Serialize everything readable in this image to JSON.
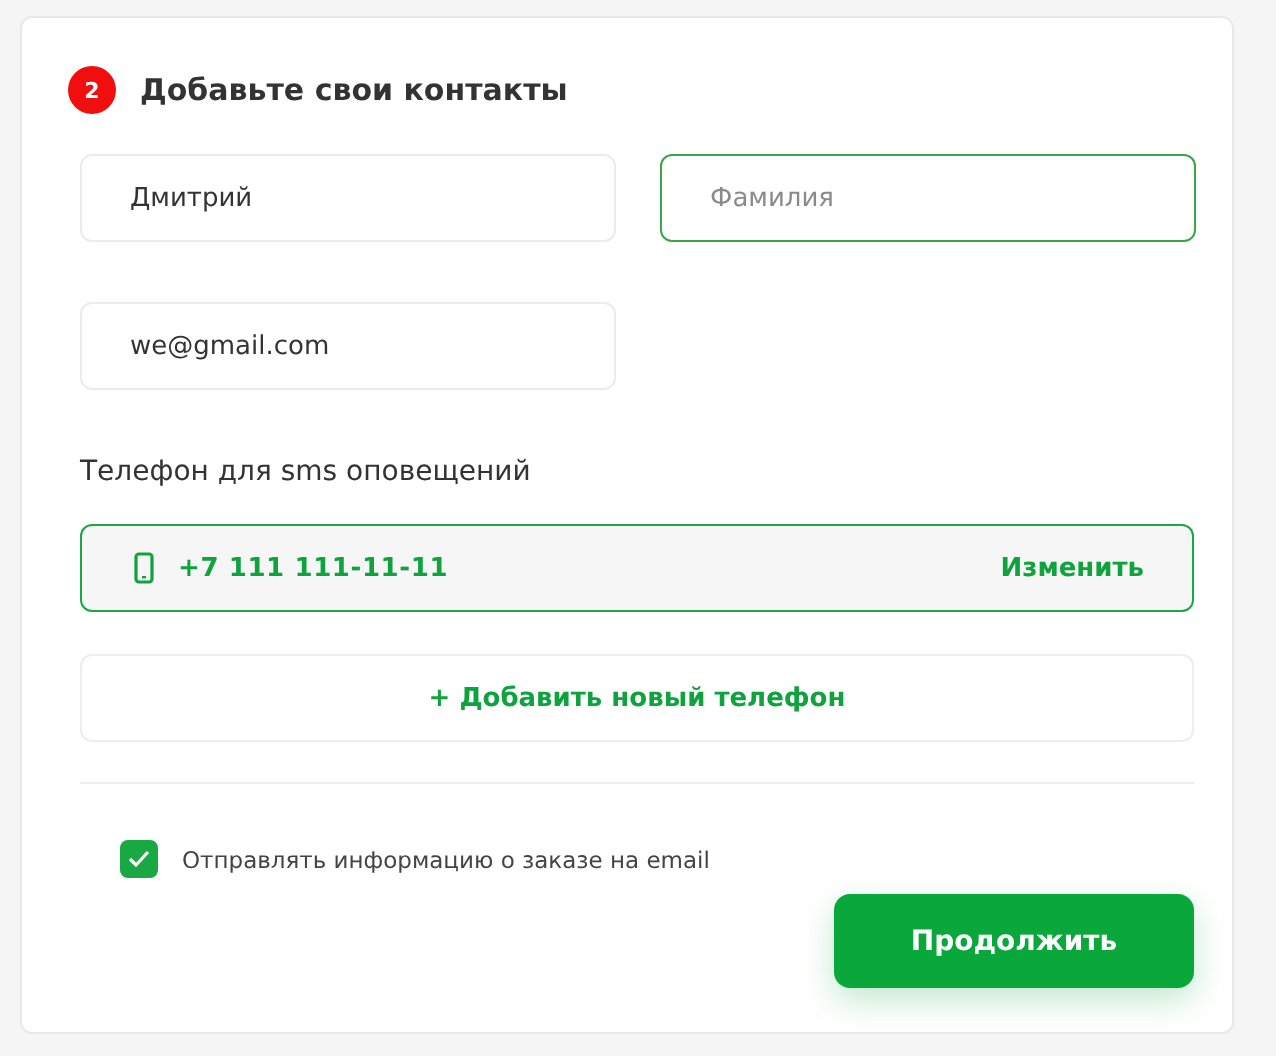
{
  "step": {
    "number": "2",
    "title": "Добавьте свои контакты"
  },
  "fields": [
    {
      "value": "Дмитрий",
      "focused": false
    },
    {
      "placeholder": "Фамилия",
      "focused": true
    },
    {
      "value": "we@gmail.com",
      "focused": false
    }
  ],
  "phone_section": {
    "label": "Телефон для sms оповещений",
    "phone": "+7 111 111-11-11",
    "change_link": "Изменить",
    "add_button": "+ Добавить новый телефон"
  },
  "email_notify": {
    "label": "Отправлять информацию о заказе на email",
    "checked": true
  },
  "continue_button": "Продолжить"
}
